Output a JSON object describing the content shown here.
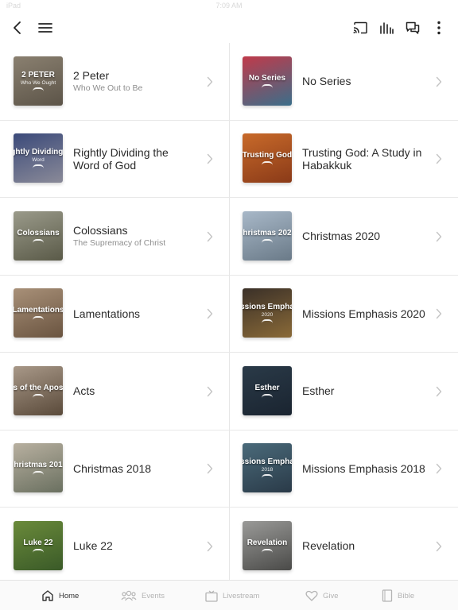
{
  "status_bar": {
    "left": "iPad",
    "time": "7:09 AM"
  },
  "header": {
    "back": "back-icon",
    "menu": "hamburger-menu-icon",
    "actions": [
      "cast-icon",
      "audio-bars-icon",
      "chat-icon",
      "more-vertical-icon"
    ]
  },
  "series": [
    {
      "title": "2 Peter",
      "subtitle": "Who We Out to Be",
      "thumb_text": "2 PETER",
      "thumb_sub": "Who We Ought",
      "thumb_colors": [
        "#8a8070",
        "#5c5448"
      ]
    },
    {
      "title": "No Series",
      "subtitle": "",
      "thumb_text": "No Series",
      "thumb_sub": "",
      "thumb_colors": [
        "#c03a4a",
        "#3b6e8a"
      ]
    },
    {
      "title": "Rightly Dividing the Word of God",
      "subtitle": "",
      "thumb_text": "ightly Dividing t",
      "thumb_sub": "Word",
      "thumb_colors": [
        "#3b4a7a",
        "#8a8a98"
      ]
    },
    {
      "title": "Trusting God: A Study in Habakkuk",
      "subtitle": "",
      "thumb_text": "Trusting God",
      "thumb_sub": "",
      "thumb_colors": [
        "#c86a2a",
        "#8a3a18"
      ]
    },
    {
      "title": "Colossians",
      "subtitle": "The Supremacy of Christ",
      "thumb_text": "Colossians",
      "thumb_sub": "",
      "thumb_colors": [
        "#9a9a8a",
        "#5a5a48"
      ]
    },
    {
      "title": "Christmas 2020",
      "subtitle": "",
      "thumb_text": "hristmas 202",
      "thumb_sub": "",
      "thumb_colors": [
        "#a8b8c8",
        "#6a7a88"
      ]
    },
    {
      "title": "Lamentations",
      "subtitle": "",
      "thumb_text": "Lamentations",
      "thumb_sub": "",
      "thumb_colors": [
        "#a89078",
        "#6a5440"
      ]
    },
    {
      "title": "Missions Emphasis 2020",
      "subtitle": "",
      "thumb_text": "ssions Empha",
      "thumb_sub": "2020",
      "thumb_colors": [
        "#3a3028",
        "#8a6a38"
      ]
    },
    {
      "title": "Acts",
      "subtitle": "",
      "thumb_text": "ts of the Apost",
      "thumb_sub": "",
      "thumb_colors": [
        "#a89888",
        "#5a4a3a"
      ]
    },
    {
      "title": "Esther",
      "subtitle": "",
      "thumb_text": "Esther",
      "thumb_sub": "",
      "thumb_colors": [
        "#2a3a48",
        "#1a2430"
      ]
    },
    {
      "title": "Christmas 2018",
      "subtitle": "",
      "thumb_text": "hristmas 201",
      "thumb_sub": "",
      "thumb_colors": [
        "#b8b0a0",
        "#6a7060"
      ]
    },
    {
      "title": "Missions Emphasis 2018",
      "subtitle": "",
      "thumb_text": "ssions Empha",
      "thumb_sub": "2018",
      "thumb_colors": [
        "#4a6a7a",
        "#2a3a48"
      ]
    },
    {
      "title": "Luke 22",
      "subtitle": "",
      "thumb_text": "Luke 22",
      "thumb_sub": "",
      "thumb_colors": [
        "#6a8a3a",
        "#3a5a28"
      ]
    },
    {
      "title": "Revelation",
      "subtitle": "",
      "thumb_text": "Revelation",
      "thumb_sub": "",
      "thumb_colors": [
        "#9a9a98",
        "#4a4a48"
      ]
    }
  ],
  "tabs": [
    {
      "label": "Home",
      "icon": "home-icon",
      "active": true
    },
    {
      "label": "Events",
      "icon": "people-icon",
      "active": false
    },
    {
      "label": "Livestream",
      "icon": "tv-icon",
      "active": false
    },
    {
      "label": "Give",
      "icon": "heart-icon",
      "active": false
    },
    {
      "label": "Bible",
      "icon": "book-icon",
      "active": false
    }
  ],
  "colors": {
    "active_tab": "#333333",
    "inactive_tab": "#b4b4b4",
    "divider": "#e8e8e8"
  }
}
